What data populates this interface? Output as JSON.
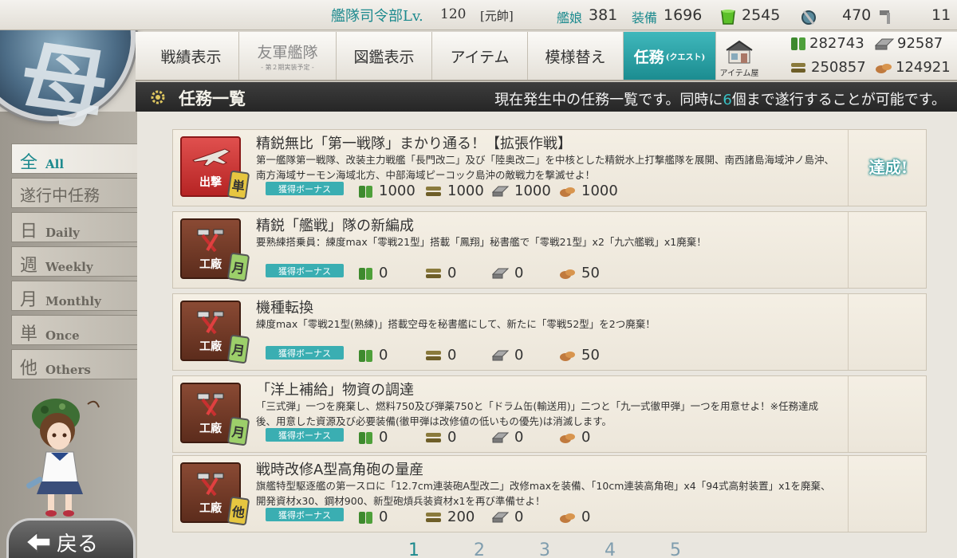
{
  "header": {
    "hq_label": "艦隊司令部Lv.",
    "hq_level": "120",
    "rank": "[元帥]",
    "ships_label": "艦娘",
    "ships_count": "381",
    "equip_label": "装備",
    "equip_count": "1696",
    "bucket_count": "2545",
    "dev_material_count": "470",
    "screw_count": "11"
  },
  "menu": {
    "items": [
      {
        "label": "戦績表示"
      },
      {
        "label": "友軍艦隊",
        "sub": "- 第２期実装予定 -"
      },
      {
        "label": "図鑑表示"
      },
      {
        "label": "アイテム"
      },
      {
        "label": "模様替え"
      },
      {
        "label": "任務",
        "tag": "(クエスト)"
      }
    ],
    "item_shop_label": "アイテム屋"
  },
  "resources": {
    "fuel": "282743",
    "steel": "92587",
    "ammo": "250857",
    "bauxite": "124921"
  },
  "title": {
    "text": "任務一覧",
    "desc_pre": "現在発生中の任務一覧です。同時に",
    "desc_num": "6",
    "desc_post": "個まで遂行することが可能です。"
  },
  "filters": [
    {
      "kanji": "全",
      "en": "All"
    },
    {
      "kanji": "遂行中任務",
      "en": ""
    },
    {
      "kanji": "日",
      "en": "Daily"
    },
    {
      "kanji": "週",
      "en": "Weekly"
    },
    {
      "kanji": "月",
      "en": "Monthly"
    },
    {
      "kanji": "単",
      "en": "Once"
    },
    {
      "kanji": "他",
      "en": "Others"
    }
  ],
  "back_label": "戻る",
  "bonus_label": "獲得ボーナス",
  "achieved_label": "達成!",
  "quests": [
    {
      "category": "出撃",
      "badge": "単",
      "title": "精鋭無比「第一戦隊」まかり通る！【拡張作戦】",
      "desc": "第一艦隊第一戦隊、改装主力戦艦「長門改二」及び「陸奥改二」を中核とした精鋭水上打撃艦隊を展開、南西諸島海域沖ノ島沖、南方海域サーモン海域北方、中部海域ピーコック島沖の敵戦力を撃滅せよ！",
      "rewards": {
        "fuel": "1000",
        "ammo": "1000",
        "steel": "1000",
        "bauxite": "1000"
      }
    },
    {
      "category": "工廠",
      "badge": "月",
      "title": "精鋭「艦戦」隊の新編成",
      "desc": "要熟練搭乗員：練度max「零戦21型」搭載「鳳翔」秘書艦で「零戦21型」x2「九六艦戦」x1廃棄！",
      "rewards": {
        "fuel": "0",
        "ammo": "0",
        "steel": "0",
        "bauxite": "50"
      }
    },
    {
      "category": "工廠",
      "badge": "月",
      "title": "機種転換",
      "desc": "練度max「零戦21型(熟練)」搭載空母を秘書艦にして、新たに「零戦52型」を2つ廃棄！",
      "rewards": {
        "fuel": "0",
        "ammo": "0",
        "steel": "0",
        "bauxite": "50"
      }
    },
    {
      "category": "工廠",
      "badge": "月",
      "title": "「洋上補給」物資の調達",
      "desc": "「三式弾」一つを廃棄し、燃料750及び弾薬750と「ドラム缶(輸送用)」二つと「九一式徹甲弾」一つを用意せよ！※任務達成後、用意した資源及び必要装備(徹甲弾は改修値の低いもの優先)は消滅します。",
      "rewards": {
        "fuel": "0",
        "ammo": "0",
        "steel": "0",
        "bauxite": "0"
      }
    },
    {
      "category": "工廠",
      "badge": "他",
      "title": "戦時改修A型高角砲の量産",
      "desc": "旗艦特型駆逐艦の第一スロに「12.7cm連装砲A型改二」改修maxを装備、「10cm連装高角砲」x4「94式高射装置」x1を廃棄、開発資材x30、鋼材900、新型砲熕兵装資材x1を再び準備せよ！",
      "rewards": {
        "fuel": "0",
        "ammo": "200",
        "steel": "0",
        "bauxite": "0"
      }
    }
  ],
  "pagination": [
    "1",
    "2",
    "3",
    "4",
    "5"
  ],
  "colors": {
    "accent": "#1d8a8e",
    "sortie": "#c83030",
    "arsenal": "#6e3a26",
    "bonus": "#3aaeb2"
  }
}
